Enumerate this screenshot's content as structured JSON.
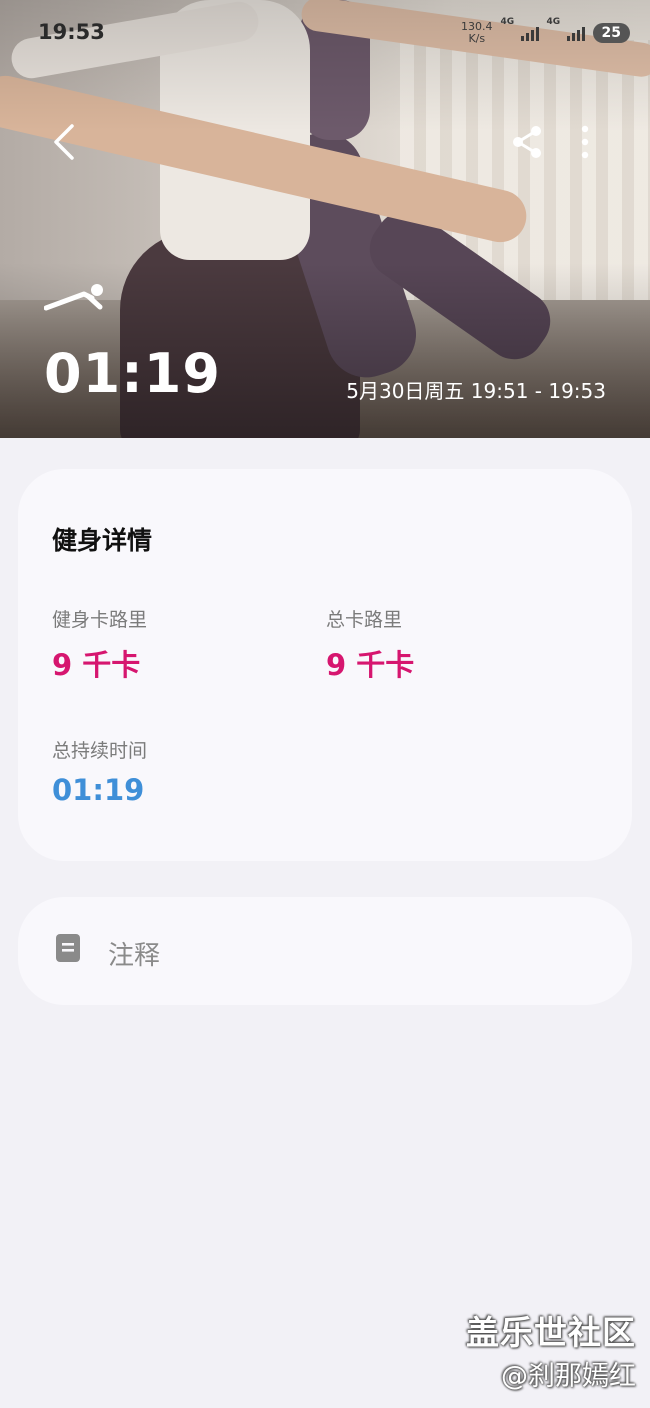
{
  "status_bar": {
    "time": "19:53",
    "net_speed_value": "130.4",
    "net_speed_unit": "K/s",
    "network_label_1": "4G",
    "network_label_2": "4G",
    "battery": "25"
  },
  "header": {
    "workout_icon": "plank-exercise-icon",
    "duration": "01:19",
    "date_range": "5月30日周五 19:51 - 19:53"
  },
  "details": {
    "title": "健身详情",
    "metrics": [
      {
        "label": "健身卡路里",
        "value": "9 千卡"
      },
      {
        "label": "总卡路里",
        "value": "9 千卡"
      },
      {
        "label": "总持续时间",
        "value": "01:19"
      }
    ]
  },
  "notes": {
    "label": "注释",
    "icon": "note-icon"
  },
  "watermark": {
    "line1": "盖乐世社区",
    "line2": "@刹那嫣红"
  },
  "colors": {
    "calorie_value": "#d6166f",
    "duration_value": "#3f8fd8",
    "background": "#f2f1f6",
    "card": "#f9f8fc"
  }
}
